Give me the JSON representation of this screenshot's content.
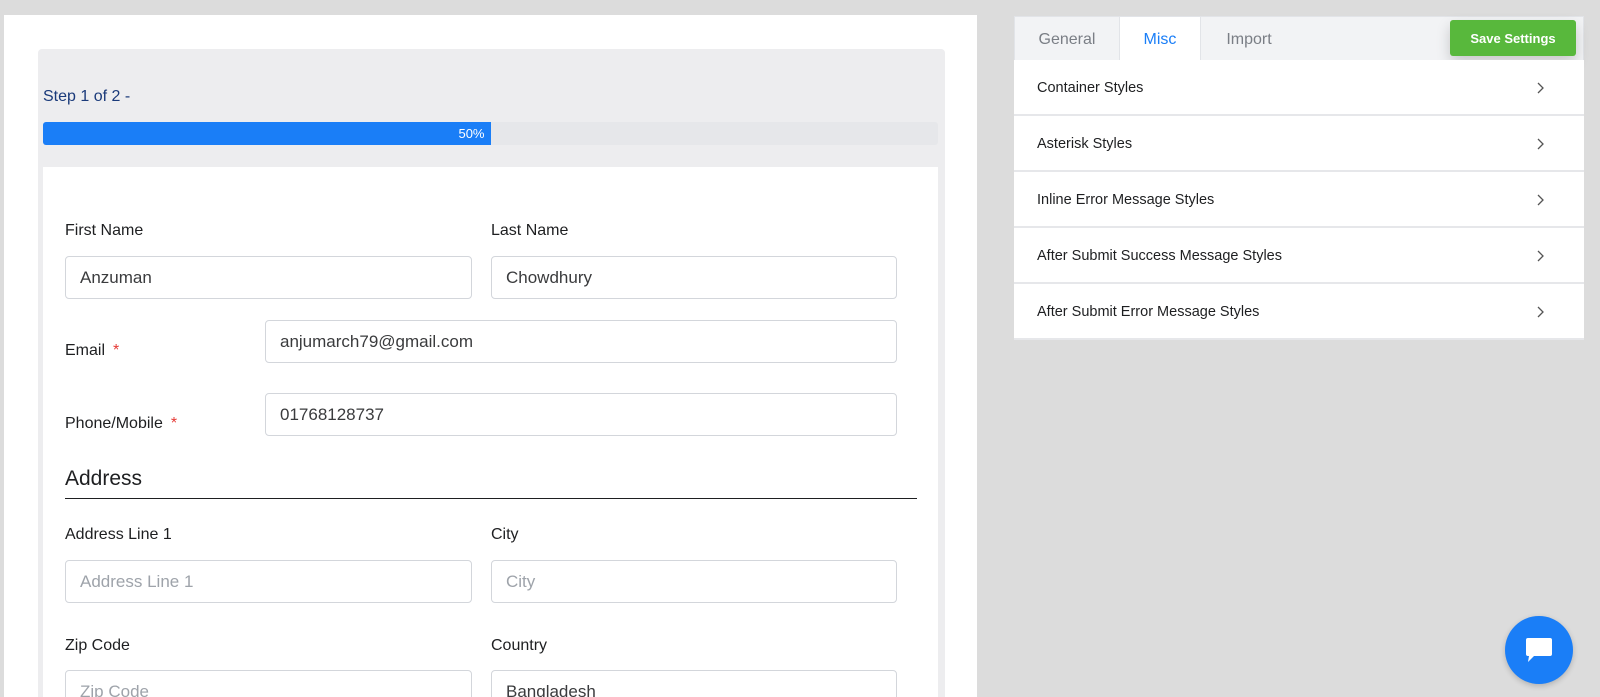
{
  "preview": {
    "step_label": "Step 1 of 2 -",
    "progress": {
      "percent": 50,
      "text": "50%"
    },
    "fields": {
      "first_name": {
        "label": "First Name",
        "value": "Anzuman"
      },
      "last_name": {
        "label": "Last Name",
        "value": "Chowdhury"
      },
      "email": {
        "label": "Email",
        "required": "*",
        "value": "anjumarch79@gmail.com"
      },
      "phone": {
        "label": "Phone/Mobile",
        "required": "*",
        "value": "01768128737"
      },
      "address_line1": {
        "label": "Address Line 1",
        "placeholder": "Address Line 1"
      },
      "city": {
        "label": "City",
        "placeholder": "City"
      },
      "zip": {
        "label": "Zip Code",
        "placeholder": "Zip Code"
      },
      "country": {
        "label": "Country",
        "value": "Bangladesh"
      }
    },
    "address_title": "Address"
  },
  "settings": {
    "tabs": [
      {
        "label": "General"
      },
      {
        "label": "Misc"
      },
      {
        "label": "Import"
      }
    ],
    "active_tab": "Misc",
    "save_label": "Save Settings",
    "accordion": [
      {
        "label": "Container Styles"
      },
      {
        "label": "Asterisk Styles"
      },
      {
        "label": "Inline Error Message Styles"
      },
      {
        "label": "After Submit Success Message Styles"
      },
      {
        "label": "After Submit Error Message Styles"
      }
    ]
  },
  "icons": {
    "chevron": "chevron-right-icon",
    "chat": "chat-bubble-icon"
  },
  "colors": {
    "accent": "#1a7ef7",
    "save": "#58b83c",
    "required": "#e53935"
  }
}
